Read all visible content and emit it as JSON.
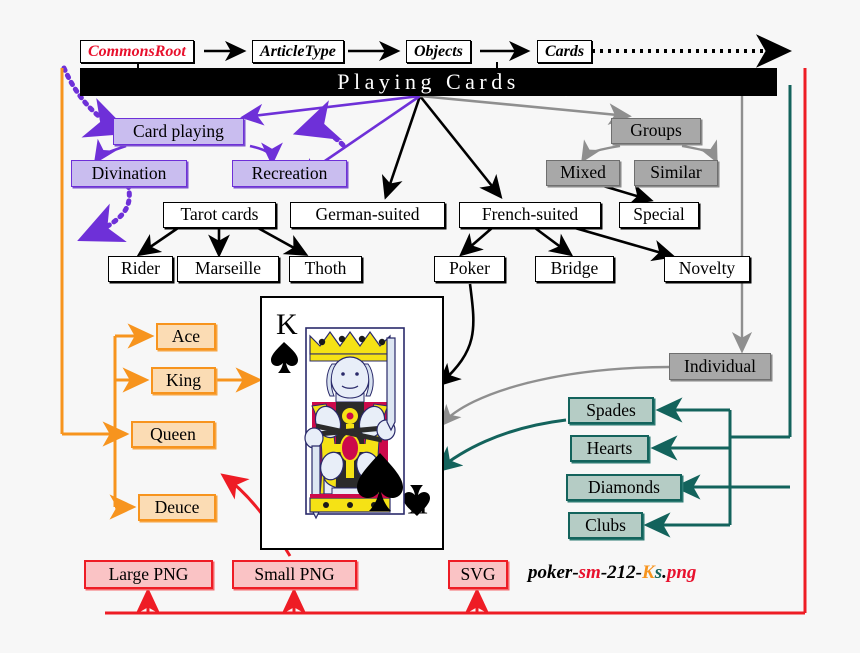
{
  "diagram": {
    "title": "Playing Cards",
    "banner_arrow": "down-arrow"
  },
  "breadcrumb": {
    "items": [
      {
        "label": "CommonsRoot",
        "color": "#e8112d"
      },
      {
        "label": "ArticleType",
        "color": "#000000"
      },
      {
        "label": "Objects",
        "color": "#000000"
      },
      {
        "label": "Cards",
        "color": "#000000"
      }
    ]
  },
  "purple_nodes": [
    {
      "label": "Card playing"
    },
    {
      "label": "Divination"
    },
    {
      "label": "Recreation"
    }
  ],
  "gray_nodes": [
    {
      "label": "Groups"
    },
    {
      "label": "Mixed"
    },
    {
      "label": "Similar"
    },
    {
      "label": "Individual"
    }
  ],
  "white_nodes": [
    {
      "label": "Tarot cards"
    },
    {
      "label": "German-suited"
    },
    {
      "label": "French-suited"
    },
    {
      "label": "Special"
    },
    {
      "label": "Rider"
    },
    {
      "label": "Marseille"
    },
    {
      "label": "Thoth"
    },
    {
      "label": "Poker"
    },
    {
      "label": "Bridge"
    },
    {
      "label": "Novelty"
    }
  ],
  "rank_nodes": [
    {
      "label": "Ace"
    },
    {
      "label": "King"
    },
    {
      "label": "Queen"
    },
    {
      "label": "Deuce"
    }
  ],
  "suit_nodes": [
    {
      "label": "Spades"
    },
    {
      "label": "Hearts"
    },
    {
      "label": "Diamonds"
    },
    {
      "label": "Clubs"
    }
  ],
  "format_nodes": [
    {
      "label": "Large PNG"
    },
    {
      "label": "Small PNG"
    },
    {
      "label": "SVG"
    }
  ],
  "filename": {
    "parts": [
      {
        "text": "poker-",
        "role": "base"
      },
      {
        "text": "sm",
        "role": "size"
      },
      {
        "text": "-212-",
        "role": "base"
      },
      {
        "text": "K",
        "role": "rank"
      },
      {
        "text": "s",
        "role": "suit"
      },
      {
        "text": ".",
        "role": "base"
      },
      {
        "text": "png",
        "role": "format"
      }
    ],
    "full": "poker-sm-212-Ks.png"
  },
  "card": {
    "rank": "K",
    "suit": "spade",
    "name": "King of Spades"
  },
  "colors": {
    "purple_fill": "#c9bdef",
    "purple_border": "#6e30d8",
    "gray_fill": "#a8a8a8",
    "gray_border": "#6f6f6f",
    "orange_fill": "#fbdcb4",
    "orange_border": "#f7941e",
    "teal_fill": "#b5ccc5",
    "teal_border": "#13635c",
    "red_fill": "#fac3c5",
    "red_border": "#ee1c25",
    "banner_bg": "#000000",
    "root_text": "#e8112d"
  }
}
